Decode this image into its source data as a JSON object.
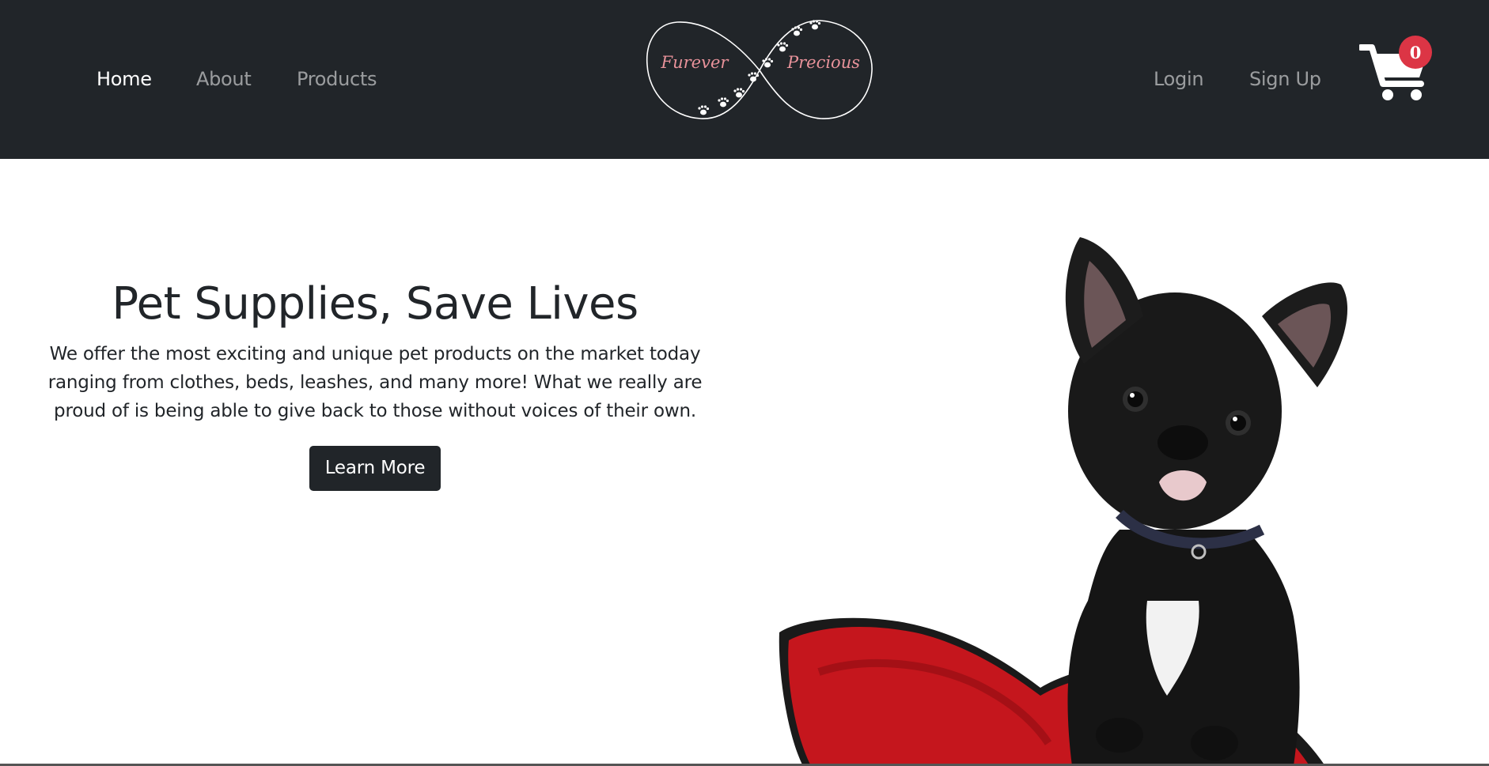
{
  "nav": {
    "left_links": [
      {
        "label": "Home",
        "active": true
      },
      {
        "label": "About",
        "active": false
      },
      {
        "label": "Products",
        "active": false
      }
    ],
    "right_links": [
      {
        "label": "Login"
      },
      {
        "label": "Sign Up"
      }
    ],
    "logo": {
      "word_left": "Furever",
      "word_right": "Precious",
      "icon": "infinity-paw-prints-logo",
      "text_color": "#e8929a"
    },
    "cart": {
      "icon": "shopping-cart-icon",
      "count": "0",
      "badge_color": "#dc3545"
    }
  },
  "hero": {
    "title": "Pet Supplies, Save Lives",
    "text": "We offer the most exciting and unique pet products on the market today ranging from clothes, beds, leashes, and many more! What we really are proud of is being able to give back to those without voices of their own.",
    "button_label": "Learn More",
    "image": "french-bulldog-on-red-heart-pillow"
  },
  "colors": {
    "navbar_bg": "#212529",
    "nav_active": "#ffffff",
    "nav_inactive": "#9a9da0",
    "button_bg": "#212529"
  }
}
